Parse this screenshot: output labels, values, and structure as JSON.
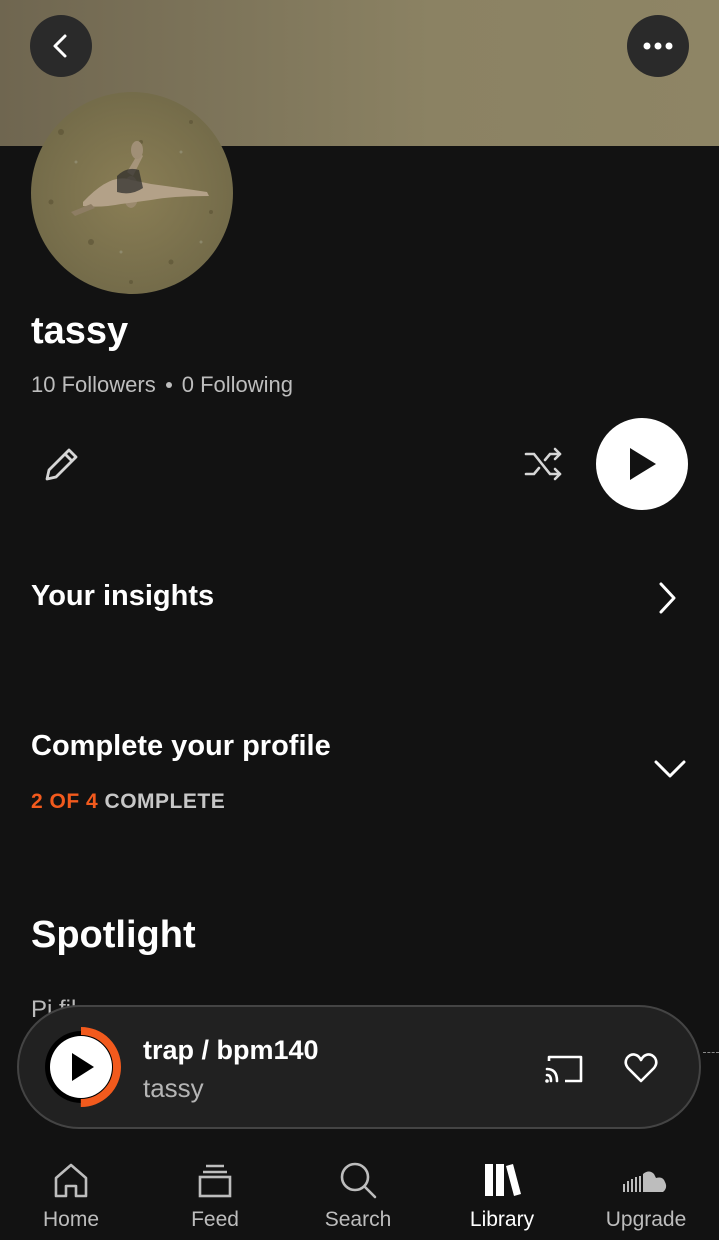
{
  "profile": {
    "username": "tassy",
    "followers_count": "10 Followers",
    "following_count": "0 Following"
  },
  "insights": {
    "label": "Your insights"
  },
  "complete_profile": {
    "title": "Complete your profile",
    "progress_count": "2 OF 4",
    "progress_word": "COMPLETE"
  },
  "spotlight": {
    "title": "Spotlight",
    "subtitle_partial": "Pi                              fil"
  },
  "player": {
    "track_title": "trap / bpm140",
    "artist": "tassy",
    "progress": 0.5
  },
  "nav": {
    "items": [
      {
        "label": "Home",
        "icon": "home-icon"
      },
      {
        "label": "Feed",
        "icon": "feed-icon"
      },
      {
        "label": "Search",
        "icon": "search-icon"
      },
      {
        "label": "Library",
        "icon": "library-icon",
        "active": true
      },
      {
        "label": "Upgrade",
        "icon": "soundcloud-icon"
      }
    ]
  },
  "colors": {
    "accent": "#f25a1d",
    "background": "#121212",
    "banner": "#8b8263"
  }
}
